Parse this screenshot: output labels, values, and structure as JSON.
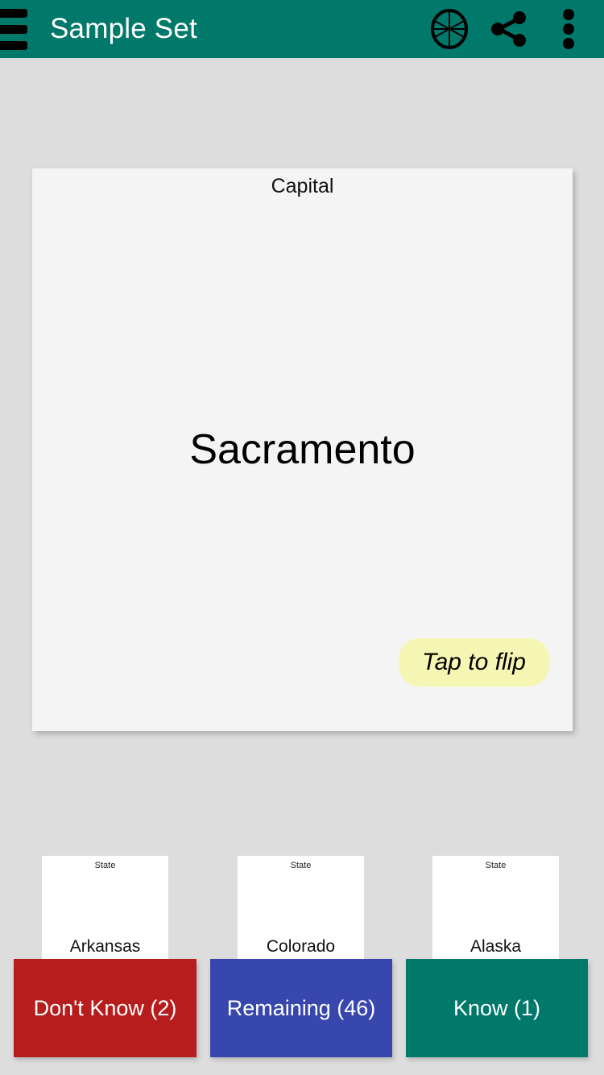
{
  "appbar": {
    "title": "Sample Set",
    "menu_icon": "hamburger-menu-icon",
    "shuffle_icon": "wheel-shuffle-icon",
    "share_icon": "share-icon",
    "overflow_icon": "more-vertical-icon",
    "background_color": "#00796b",
    "title_color": "#ffffff"
  },
  "card": {
    "label": "Capital",
    "term": "Sacramento",
    "flip_hint": "Tap to flip",
    "background_color": "#f4f4f4",
    "flip_hint_color": "#f6f6b4"
  },
  "mini_cards": [
    {
      "label": "State",
      "term": "Arkansas"
    },
    {
      "label": "State",
      "term": "Colorado"
    },
    {
      "label": "State",
      "term": "Alaska"
    }
  ],
  "actions": [
    {
      "label": "Don't Know (2)",
      "count": 2,
      "color": "#b81d1d"
    },
    {
      "label": "Remaining (46)",
      "count": 46,
      "color": "#3847ad"
    },
    {
      "label": "Know (1)",
      "count": 1,
      "color": "#00796b"
    }
  ],
  "page": {
    "background_color": "#dddddd"
  }
}
